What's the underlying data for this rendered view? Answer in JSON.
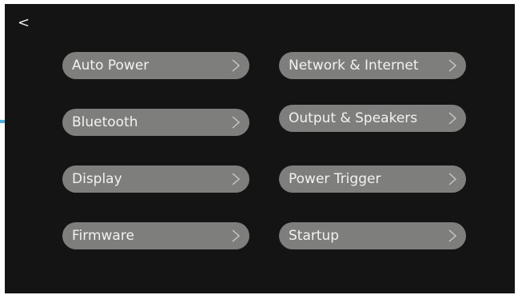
{
  "nav": {
    "back_label": "<"
  },
  "menu": {
    "left": [
      {
        "label": "Auto Power",
        "icon": "chevron-right-icon"
      },
      {
        "label": "Bluetooth",
        "icon": "chevron-right-icon"
      },
      {
        "label": "Display",
        "icon": "chevron-right-icon"
      },
      {
        "label": "Firmware",
        "icon": "chevron-right-icon"
      }
    ],
    "right": [
      {
        "label": "Network & Internet",
        "icon": "chevron-right-icon"
      },
      {
        "label": "Output & Speakers",
        "icon": "chevron-right-icon"
      },
      {
        "label": "Power Trigger",
        "icon": "chevron-right-icon"
      },
      {
        "label": "Startup",
        "icon": "chevron-right-icon"
      }
    ]
  },
  "highlight": {
    "target": "Bluetooth",
    "color": "#4aaee3"
  },
  "colors": {
    "screen_bg": "#151414",
    "button_bg": "#7e7e7d",
    "button_text": "#f2f2f2"
  }
}
